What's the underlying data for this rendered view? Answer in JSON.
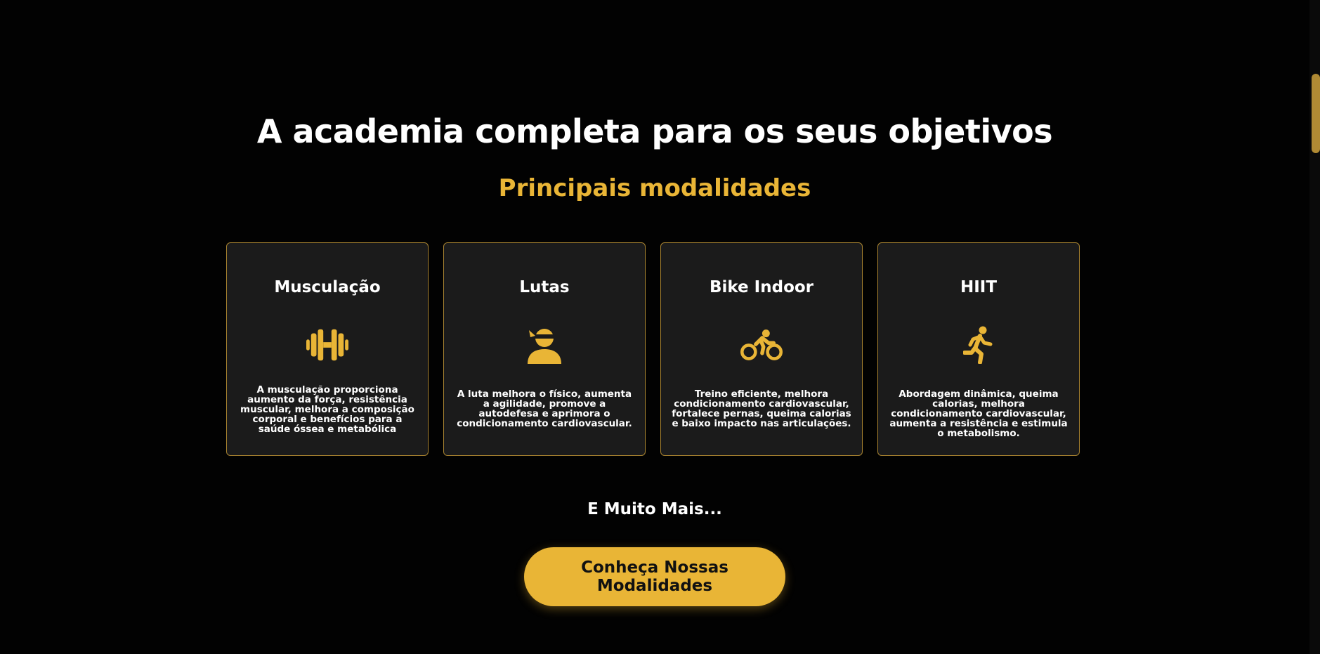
{
  "section": {
    "title": "A academia completa para os seus objetivos",
    "subtitle": "Principais modalidades"
  },
  "cards": [
    {
      "title": "Musculação",
      "icon": "dumbbell-icon",
      "text": "A musculação proporciona aumento da força, resistência muscular, melhora a composição corporal e benefícios para a saúde óssea e metabólica"
    },
    {
      "title": "Lutas",
      "icon": "fighter-icon",
      "text": "A luta melhora o físico, aumenta a agilidade, promove a autodefesa e aprimora o condicionamento cardiovascular."
    },
    {
      "title": "Bike Indoor",
      "icon": "cyclist-icon",
      "text": "Treino eficiente, melhora condicionamento cardiovascular, fortalece pernas, queima calorias e baixo impacto nas articulações."
    },
    {
      "title": "HIIT",
      "icon": "runner-icon",
      "text": "Abordagem dinâmica, queima calorias, melhora condicionamento cardiovascular, aumenta a resistência e estimula o metabolismo."
    }
  ],
  "more_text": "E Muito Mais...",
  "cta_label": "Conheça Nossas Modalidades",
  "colors": {
    "background": "#020202",
    "accent": "#e9b536",
    "card_background": "#1b1b1b",
    "card_border": "#a88330"
  }
}
